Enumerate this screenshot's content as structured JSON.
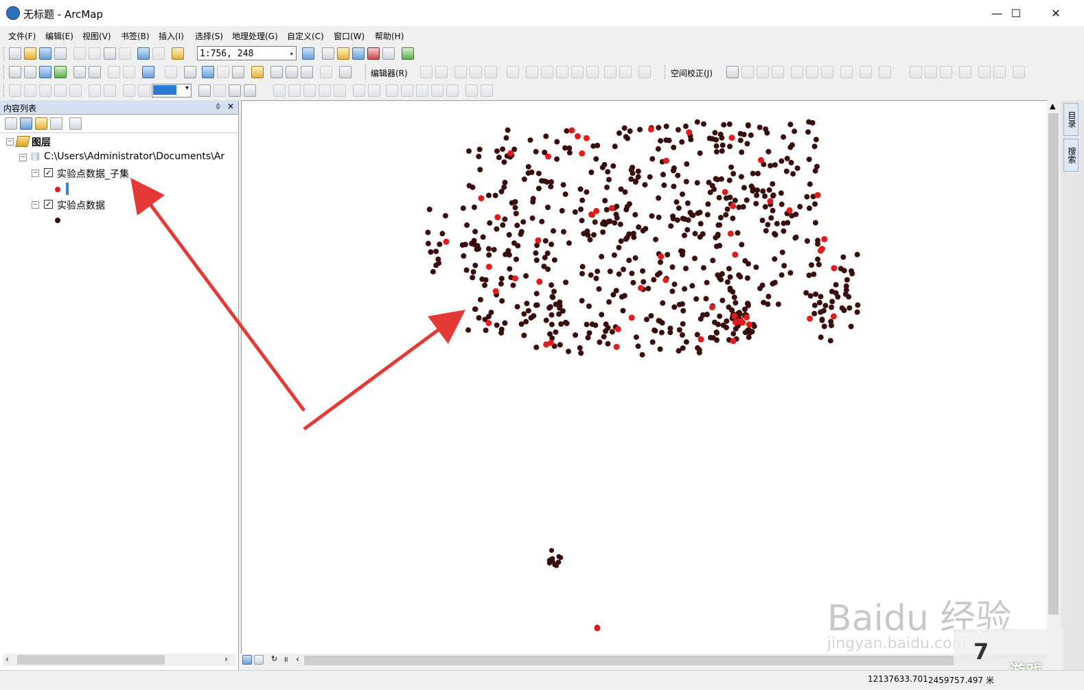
{
  "window": {
    "title": "无标题 - ArcMap",
    "minimize": "—",
    "maximize": "☐",
    "close": "✕"
  },
  "menu": [
    "文件(F)",
    "编辑(E)",
    "视图(V)",
    "书签(B)",
    "插入(I)",
    "选择(S)",
    "地理处理(G)",
    "自定义(C)",
    "窗口(W)",
    "帮助(H)"
  ],
  "toolbar": {
    "scale": "1:756, 248",
    "editor_label": "编辑器(R)",
    "georef_label": "空间校正(J)"
  },
  "toc": {
    "title": "内容列表",
    "pin": "ᛰ",
    "close": "✕",
    "root_label": "图层",
    "path_label": "C:\\Users\\Administrator\\Documents\\Ar",
    "layers": [
      {
        "name": "实验点数据_子集",
        "checked": true,
        "symbol_color": "#e21b1b"
      },
      {
        "name": "实验点数据",
        "checked": true,
        "symbol_color": "#3a0d0d"
      }
    ]
  },
  "dock_tabs": [
    "目录",
    "搜索"
  ],
  "status": {
    "x": "12137633.701",
    "y": "2459757.497 米"
  },
  "watermark": {
    "line1": "Baidu 经验",
    "line2": "jingyan.baidu.com",
    "logo1": "7",
    "logo2": "游戏"
  },
  "colors": {
    "dark_point": "#3a0d0d",
    "red_point": "#e21b1b",
    "arrow": "#e53935"
  },
  "map_points": {
    "dark_count": 620,
    "red_count": 48
  }
}
